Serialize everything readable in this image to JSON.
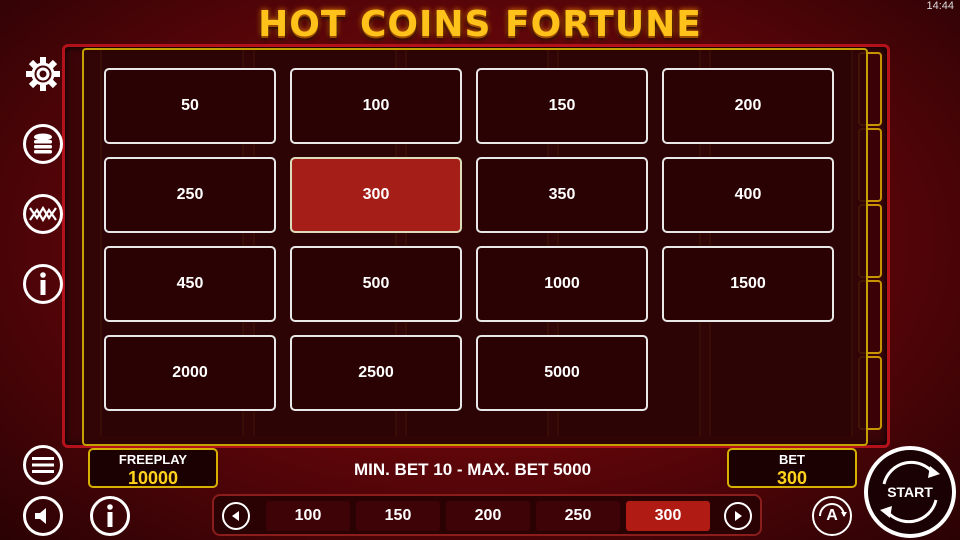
{
  "clock": "14:44",
  "title": "HOT COINS FORTUNE",
  "bet_options": [
    {
      "label": "50",
      "selected": false
    },
    {
      "label": "100",
      "selected": false
    },
    {
      "label": "150",
      "selected": false
    },
    {
      "label": "200",
      "selected": false
    },
    {
      "label": "250",
      "selected": false
    },
    {
      "label": "300",
      "selected": true
    },
    {
      "label": "350",
      "selected": false
    },
    {
      "label": "400",
      "selected": false
    },
    {
      "label": "450",
      "selected": false
    },
    {
      "label": "500",
      "selected": false
    },
    {
      "label": "1000",
      "selected": false
    },
    {
      "label": "1500",
      "selected": false
    },
    {
      "label": "2000",
      "selected": false
    },
    {
      "label": "2500",
      "selected": false
    },
    {
      "label": "5000",
      "selected": false
    }
  ],
  "sidebar_icons": [
    "settings-gear-icon",
    "coin-stack-icon",
    "paylines-icon",
    "info-icon"
  ],
  "freeplay": {
    "label": "FREEPLAY",
    "value": "10000"
  },
  "limits_text": "MIN. BET 10 - MAX. BET 5000",
  "bet": {
    "label": "BET",
    "value": "300"
  },
  "bet_bar": [
    {
      "label": "100",
      "selected": false
    },
    {
      "label": "150",
      "selected": false
    },
    {
      "label": "200",
      "selected": false
    },
    {
      "label": "250",
      "selected": false
    },
    {
      "label": "300",
      "selected": true
    }
  ],
  "autoplay_letter": "A",
  "start_label": "START",
  "colors": {
    "accent_gold": "#ffc21a",
    "selected_red": "#a51e17",
    "background": "#6b070c"
  }
}
